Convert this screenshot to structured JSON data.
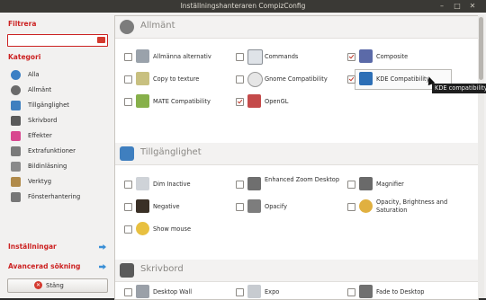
{
  "window": {
    "title": "Inställningshanteraren CompizConfig"
  },
  "sidebar": {
    "filter_label": "Filtrera",
    "filter_value": "",
    "category_label": "Kategori",
    "categories": [
      {
        "label": "Alla",
        "icon": "globe-icon",
        "color": "#3b7fc4"
      },
      {
        "label": "Allmänt",
        "icon": "gear-icon",
        "color": "#6a6a6a"
      },
      {
        "label": "Tillgänglighet",
        "icon": "accessibility-icon",
        "color": "#3f7fbf"
      },
      {
        "label": "Skrivbord",
        "icon": "desktop-icon",
        "color": "#5a5a5a"
      },
      {
        "label": "Effekter",
        "icon": "butterfly-icon",
        "color": "#d8478f"
      },
      {
        "label": "Extrafunktioner",
        "icon": "extras-icon",
        "color": "#7a7a7a"
      },
      {
        "label": "Bildinläsning",
        "icon": "image-loading-icon",
        "color": "#8a8a8a"
      },
      {
        "label": "Verktyg",
        "icon": "tools-icon",
        "color": "#b08a4a"
      },
      {
        "label": "Fönsterhantering",
        "icon": "window-management-icon",
        "color": "#777777"
      }
    ],
    "settings_label": "Inställningar",
    "advanced_search_label": "Avancerad sökning",
    "close_label": "Stäng"
  },
  "main": {
    "sections": [
      {
        "title": "Allmänt",
        "icon": "gear-icon"
      },
      {
        "title": "Tillgänglighet",
        "icon": "accessibility-icon"
      },
      {
        "title": "Skrivbord",
        "icon": "desktop-icon"
      }
    ],
    "plugins_general": [
      {
        "label": "Allmänna alternativ",
        "checked": false,
        "icon": "general-options-icon"
      },
      {
        "label": "Commands",
        "checked": false,
        "icon": "commands-icon"
      },
      {
        "label": "Composite",
        "checked": true,
        "icon": "composite-icon"
      },
      {
        "label": "Copy to texture",
        "checked": false,
        "icon": "copy-texture-icon"
      },
      {
        "label": "Gnome Compatibility",
        "checked": false,
        "icon": "gnome-icon"
      },
      {
        "label": "KDE Compatibility",
        "checked": true,
        "icon": "kde-icon"
      },
      {
        "label": "MATE Compatibility",
        "checked": false,
        "icon": "mate-icon"
      },
      {
        "label": "OpenGL",
        "checked": true,
        "icon": "opengl-icon"
      }
    ],
    "plugins_access": [
      {
        "label": "Dim Inactive",
        "checked": false,
        "icon": "dim-inactive-icon"
      },
      {
        "label": "Enhanced Zoom Desktop",
        "checked": false,
        "icon": "zoom-icon"
      },
      {
        "label": "Magnifier",
        "checked": false,
        "icon": "magnifier-icon"
      },
      {
        "label": "Negative",
        "checked": false,
        "icon": "negative-icon"
      },
      {
        "label": "Opacify",
        "checked": false,
        "icon": "opacify-icon"
      },
      {
        "label": "Opacity, Brightness and Saturation",
        "checked": false,
        "icon": "obs-icon"
      },
      {
        "label": "Show mouse",
        "checked": false,
        "icon": "show-mouse-icon"
      }
    ],
    "plugins_desktop": [
      {
        "label": "Desktop Wall",
        "checked": false,
        "icon": "desktop-wall-icon"
      },
      {
        "label": "Expo",
        "checked": false,
        "icon": "expo-icon"
      },
      {
        "label": "Fade to Desktop",
        "checked": false,
        "icon": "fade-desktop-icon"
      }
    ]
  },
  "tooltip": "KDE compatibility p",
  "colors": {
    "accent_red": "#cc2222",
    "arrow_blue": "#3a8fd6"
  }
}
